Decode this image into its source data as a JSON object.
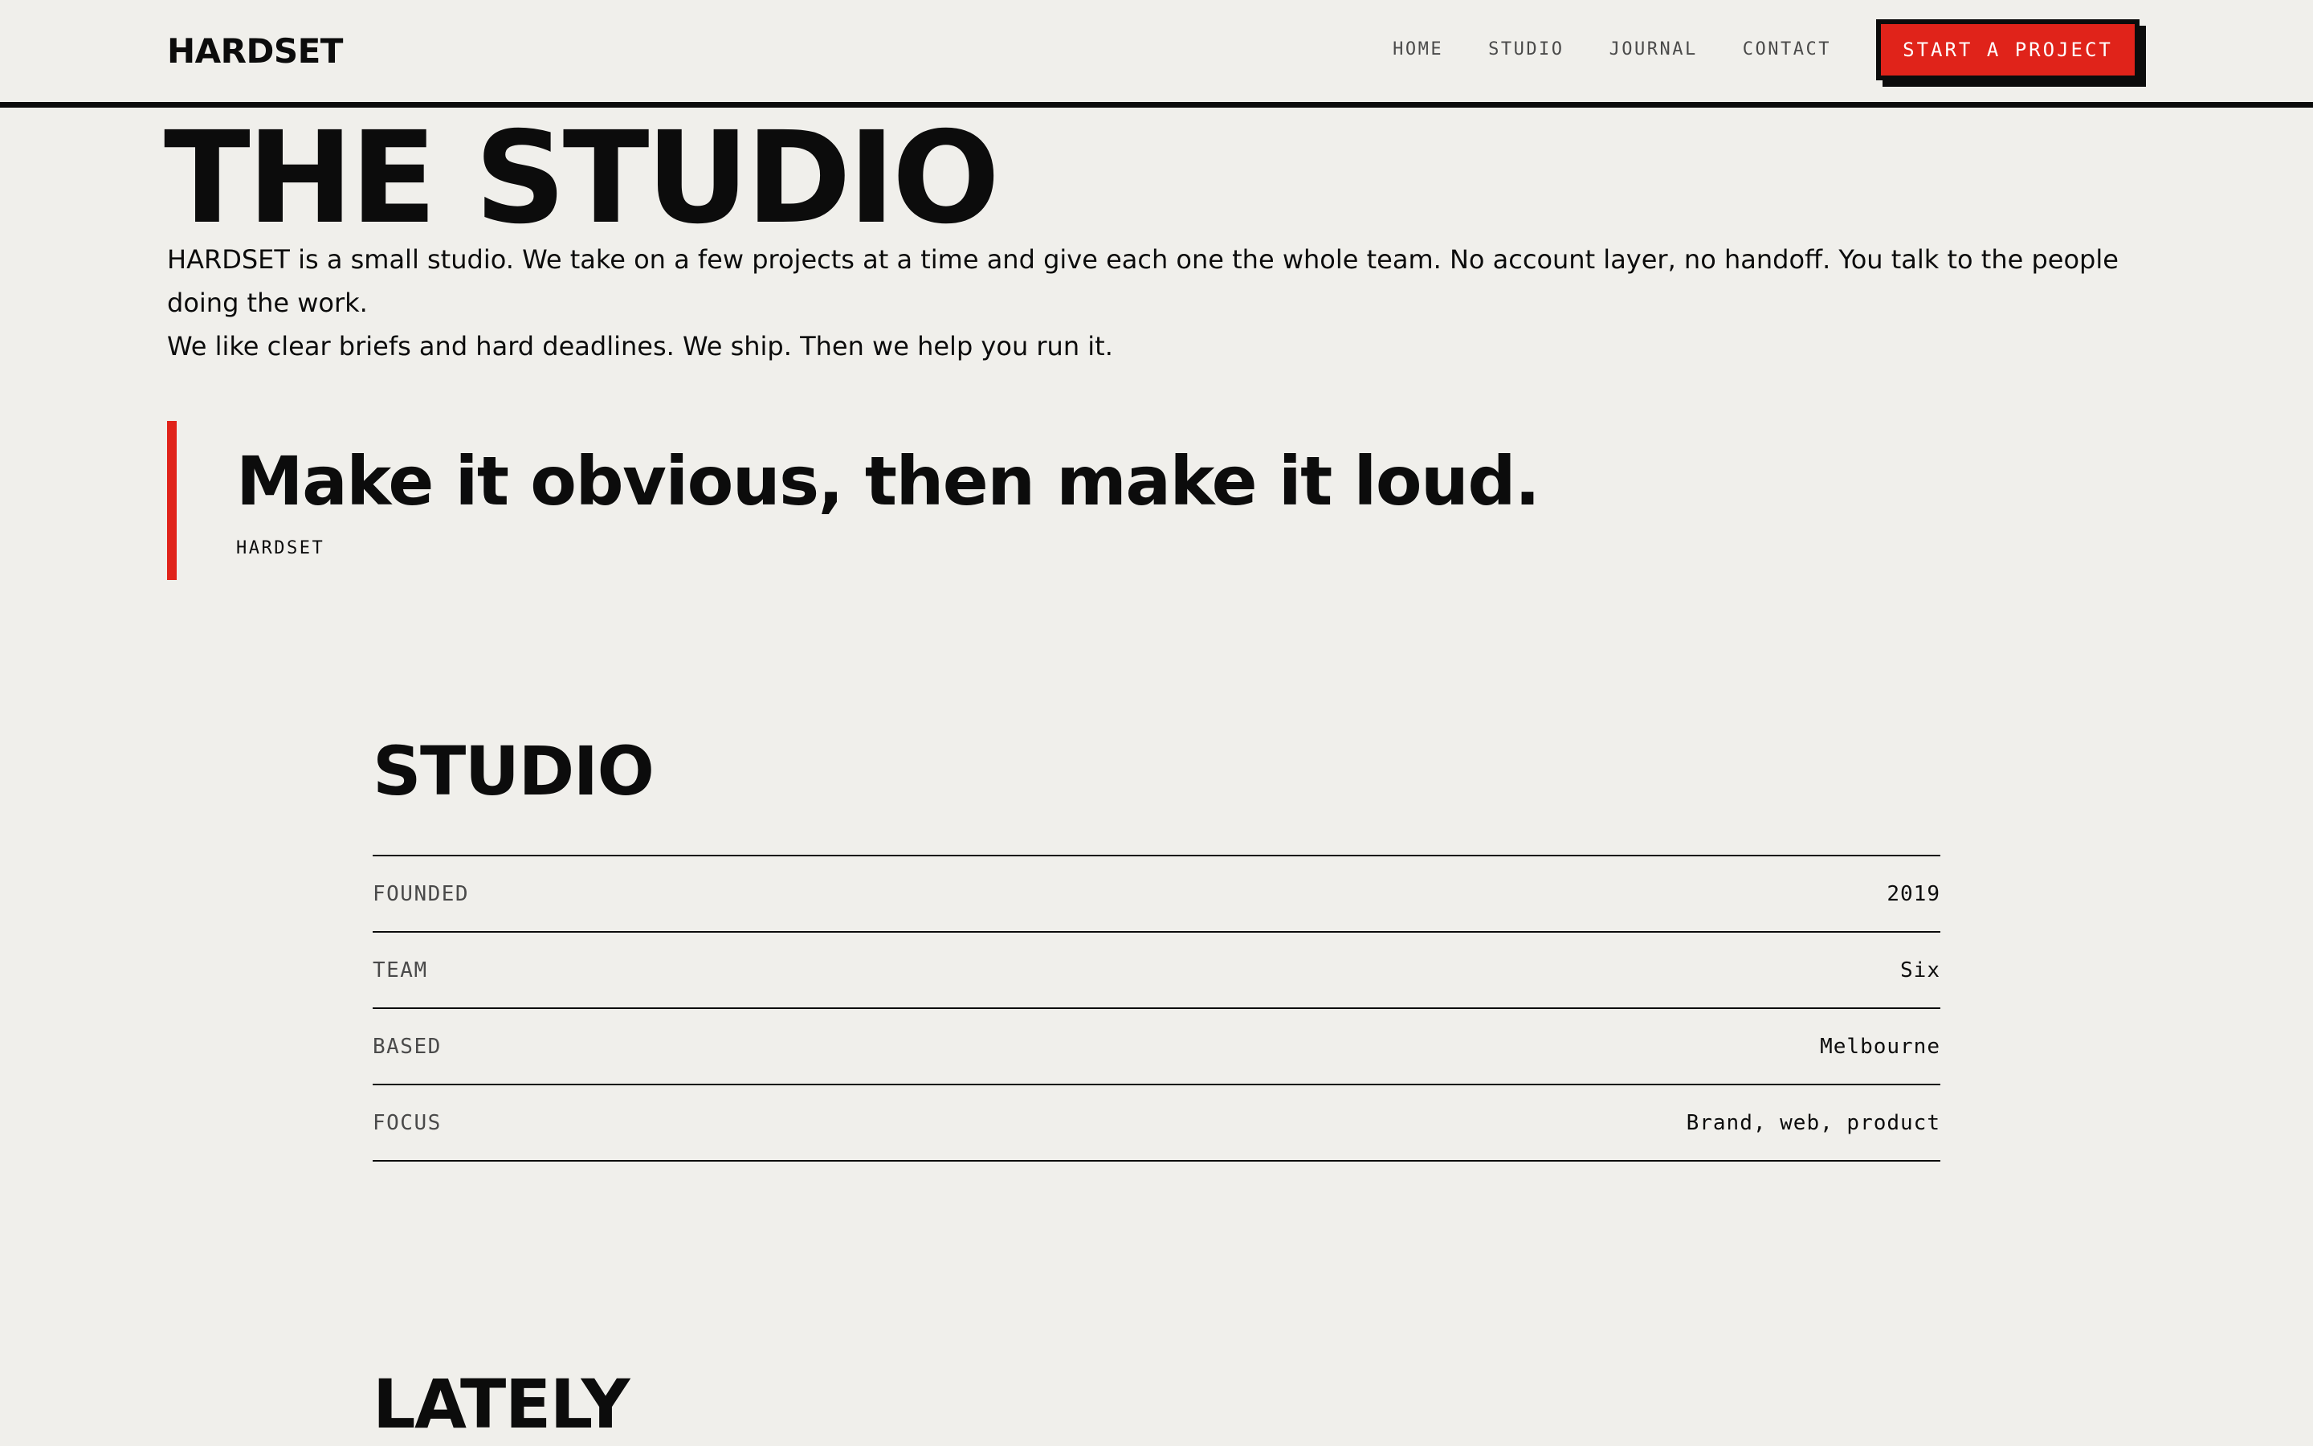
{
  "header": {
    "logo": "HARDSET",
    "nav": [
      "HOME",
      "STUDIO",
      "JOURNAL",
      "CONTACT"
    ],
    "cta_label": "START A PROJECT"
  },
  "hero": {
    "title": "THE STUDIO",
    "intro": [
      "HARDSET is a small studio. We take on a few projects at a time and give each one the whole team. No account layer, no handoff. You talk to the people doing the work.",
      "We like clear briefs and hard deadlines. We ship. Then we help you run it."
    ]
  },
  "quote": {
    "text": "Make it obvious, then make it loud.",
    "cite": "HARDSET"
  },
  "studio": {
    "title": "STUDIO",
    "facts": [
      {
        "label": "FOUNDED",
        "value": "2019"
      },
      {
        "label": "TEAM",
        "value": "Six"
      },
      {
        "label": "BASED",
        "value": "Melbourne"
      },
      {
        "label": "FOCUS",
        "value": "Brand, web, product"
      }
    ]
  },
  "lately": {
    "title": "LATELY"
  },
  "colors": {
    "background": "#f0efeb",
    "ink": "#0c0c0c",
    "accent": "#e0231a",
    "muted": "#4a4a4a"
  }
}
